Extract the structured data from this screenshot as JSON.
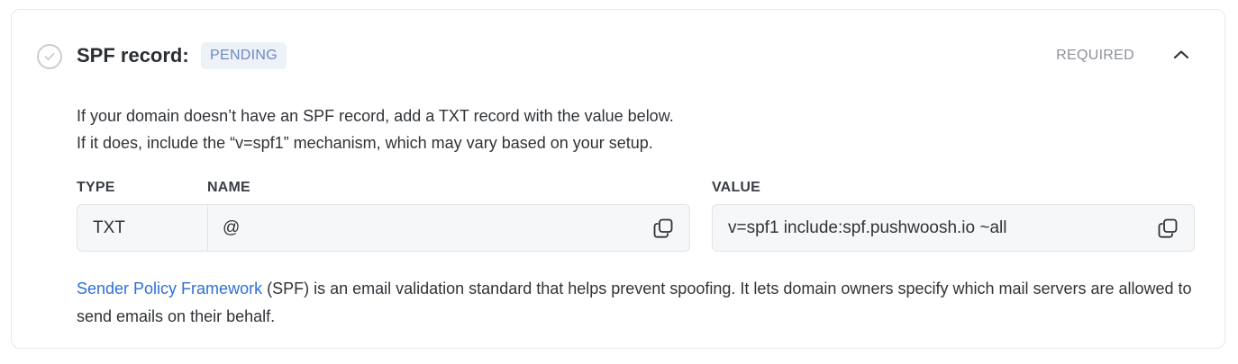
{
  "header": {
    "title": "SPF record:",
    "status_badge": "PENDING",
    "required_label": "REQUIRED",
    "status_icon": "check-circle-icon",
    "collapse_icon": "chevron-up-icon"
  },
  "description": {
    "line1": "If your domain doesn’t have an SPF record, add a TXT record with the value below.",
    "line2": "If it does, include the “v=spf1” mechanism, which may vary based on your setup."
  },
  "record": {
    "type_label": "TYPE",
    "name_label": "NAME",
    "value_label": "VALUE",
    "type": "TXT",
    "name": "@",
    "value": "v=spf1 include:spf.pushwoosh.io ~all",
    "copy_icon": "copy-icon"
  },
  "footer": {
    "link_text": "Sender Policy Framework",
    "text": " (SPF) is an email validation standard that helps prevent spoofing. It lets domain owners specify which mail servers are allowed to send emails on their behalf."
  },
  "colors": {
    "link": "#2f6fd6",
    "badge_text": "#6b89bf",
    "badge_bg": "#eef2f8"
  }
}
